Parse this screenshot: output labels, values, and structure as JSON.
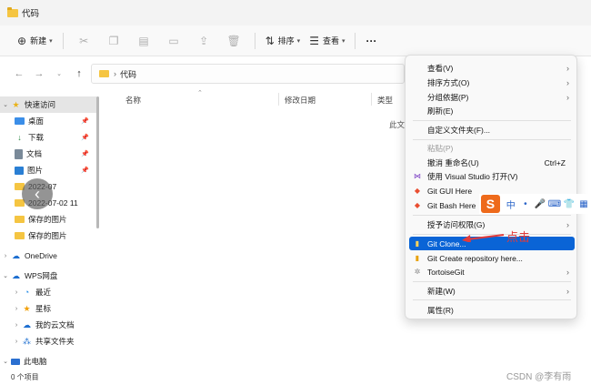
{
  "window": {
    "title": "代码"
  },
  "toolbar": {
    "new_label": "新建",
    "sort_label": "排序",
    "view_label": "查看",
    "more_label": "···"
  },
  "address": {
    "separator": "›",
    "path": "代码"
  },
  "sidebar": {
    "items": [
      {
        "label": "快速访问",
        "icon": "star-icon"
      },
      {
        "label": "桌面",
        "icon": "desktop-icon"
      },
      {
        "label": "下载",
        "icon": "download-icon"
      },
      {
        "label": "文档",
        "icon": "document-icon"
      },
      {
        "label": "图片",
        "icon": "picture-icon"
      },
      {
        "label": "2022-07",
        "icon": "folder-icon"
      },
      {
        "label": "2022-07-02 11",
        "icon": "folder-icon"
      },
      {
        "label": "保存的图片",
        "icon": "folder-icon"
      },
      {
        "label": "保存的图片",
        "icon": "folder-icon"
      },
      {
        "label": "OneDrive",
        "icon": "cloud-icon"
      },
      {
        "label": "WPS网盘",
        "icon": "cloud-icon"
      },
      {
        "label": "最近",
        "icon": "clock-icon"
      },
      {
        "label": "星标",
        "icon": "star-icon"
      },
      {
        "label": "我的云文档",
        "icon": "cloud-doc-icon"
      },
      {
        "label": "共享文件夹",
        "icon": "share-icon"
      },
      {
        "label": "此电脑",
        "icon": "computer-icon"
      }
    ]
  },
  "columns": {
    "name": "名称",
    "date": "修改日期",
    "type": "类型"
  },
  "main": {
    "empty_text": "此文"
  },
  "status": {
    "count": "0 个项目"
  },
  "context_menu": {
    "view": "查看(V)",
    "sort": "排序方式(O)",
    "group": "分组依据(P)",
    "refresh": "刷新(E)",
    "customize": "自定义文件夹(F)...",
    "paste": "粘贴(P)",
    "undo": "撤消 重命名(U)",
    "undo_shortcut": "Ctrl+Z",
    "vs": "使用 Visual Studio 打开(V)",
    "git_gui": "Git GUI Here",
    "git_bash": "Git Bash Here",
    "access": "授予访问权限(G)",
    "git_clone": "Git Clone...",
    "git_create": "Git Create repository here...",
    "tortoise": "TortoiseGit",
    "new": "新建(W)",
    "properties": "属性(R)"
  },
  "ime": {
    "logo": "S",
    "lang": "中"
  },
  "annotation": {
    "text": "点击"
  },
  "watermark": "CSDN @李有雨"
}
